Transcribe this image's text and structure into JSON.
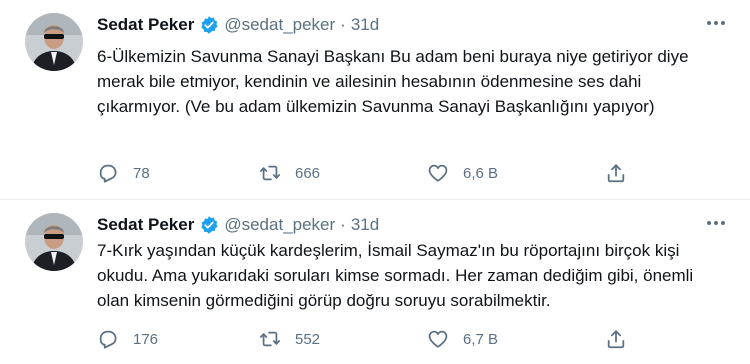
{
  "tweets": [
    {
      "name": "Sedat Peker",
      "handle": "@sedat_peker",
      "separator": "·",
      "time": "31d",
      "text": "6-Ülkemizin Savunma Sanayi Başkanı Bu adam beni buraya niye getiriyor diye merak bile etmiyor, kendinin ve ailesinin hesabının ödenmesine ses dahi çıkarmıyor. (Ve bu adam ülkemizin Savunma Sanayi Başkanlığını yapıyor)",
      "replies": "78",
      "retweets": "666",
      "likes": "6,6 B"
    },
    {
      "name": "Sedat Peker",
      "handle": "@sedat_peker",
      "separator": "·",
      "time": "31d",
      "text": "7-Kırk yaşından küçük kardeşlerim, İsmail Saymaz'ın bu röportajını birçok kişi okudu. Ama yukarıdaki soruları kimse sormadı. Her zaman dediğim gibi, önemli olan kimsenin görmediğini görüp doğru soruyu sorabilmektir.",
      "replies": "176",
      "retweets": "552",
      "likes": "6,7 B"
    }
  ],
  "colors": {
    "verified": "#1da1f2",
    "secondary_text": "#5b7083",
    "divider": "#e6ecf0"
  },
  "icons": [
    "verified-badge-icon",
    "more-icon",
    "reply-icon",
    "retweet-icon",
    "like-icon",
    "share-icon"
  ]
}
